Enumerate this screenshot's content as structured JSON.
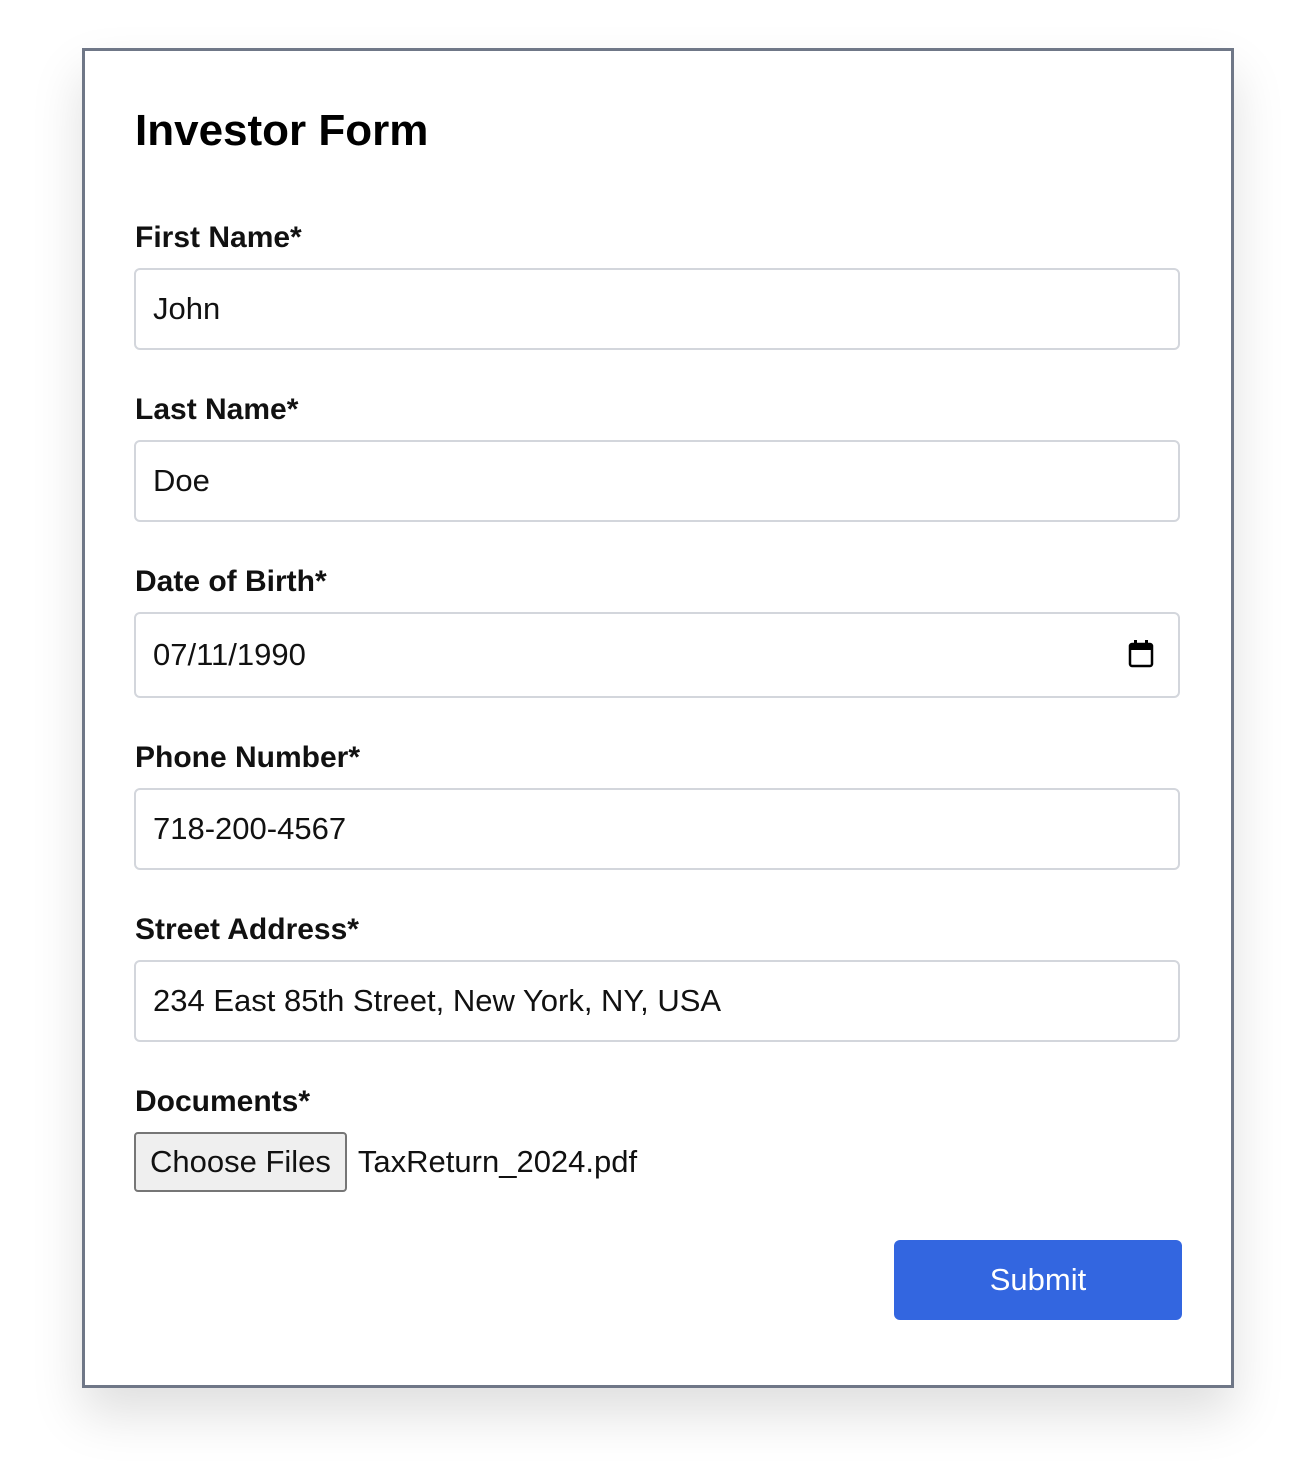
{
  "form": {
    "title": "Investor Form",
    "fields": [
      {
        "label": "First Name*",
        "value": "John"
      },
      {
        "label": "Last Name*",
        "value": "Doe"
      },
      {
        "label": "Date of Birth*",
        "value": "07/11/1990",
        "icon": "calendar-icon"
      },
      {
        "label": "Phone Number*",
        "value": "718-200-4567"
      },
      {
        "label": "Street Address*",
        "value": "234 East 85th Street, New York, NY, USA"
      }
    ],
    "documents": {
      "label": "Documents*",
      "button_label": "Choose Files",
      "file_name": "TaxReturn_2024.pdf"
    },
    "submit_label": "Submit"
  },
  "colors": {
    "card_border": "#6f7787",
    "input_border": "#d3d6dc",
    "submit_background": "#3366e0",
    "submit_text": "#ffffff"
  }
}
